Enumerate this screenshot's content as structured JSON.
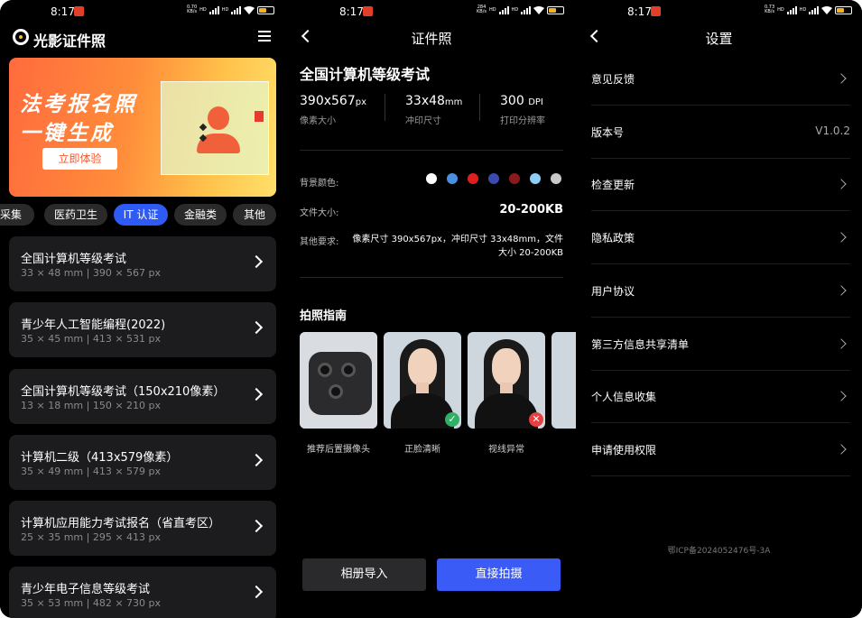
{
  "status_bar": [
    {
      "time": "8:17",
      "speed_top": "0.70",
      "speed_bottom": "KB/s",
      "battery": "80"
    },
    {
      "time": "8:17",
      "speed_top": "284",
      "speed_bottom": "KB/s",
      "battery": "80"
    },
    {
      "time": "8:17",
      "speed_top": "0.73",
      "speed_bottom": "KB/s",
      "battery": "80"
    }
  ],
  "home": {
    "app_name": "光影证件照",
    "banner": {
      "line1": "法考报名照",
      "line2": "一键生成",
      "button": "立即体验"
    },
    "tabs": [
      "采集",
      "医药卫生",
      "IT 认证",
      "金融类",
      "其他"
    ],
    "active_tab": "IT 认证",
    "items": [
      {
        "title": "全国计算机等级考试",
        "sub": "33 × 48 mm | 390 × 567 px"
      },
      {
        "title": "青少年人工智能编程(2022)",
        "sub": "35 × 45 mm | 413 × 531 px"
      },
      {
        "title": "全国计算机等级考试（150x210像素）",
        "sub": "13 × 18 mm | 150 × 210 px"
      },
      {
        "title": "计算机二级（413x579像素）",
        "sub": "35 × 49 mm | 413 × 579 px"
      },
      {
        "title": "计算机应用能力考试报名（省直考区）",
        "sub": "25 × 35 mm | 295 × 413 px"
      },
      {
        "title": "青少年电子信息等级考试",
        "sub": "35 × 53 mm | 482 × 730 px"
      }
    ]
  },
  "detail": {
    "nav_title": "证件照",
    "title": "全国计算机等级考试",
    "specs": [
      {
        "value": "390x567",
        "unit": "px",
        "label": "像素大小"
      },
      {
        "value": "33x48",
        "unit": "mm",
        "label": "冲印尺寸"
      },
      {
        "value": "300",
        "unit": "DPI",
        "label": "打印分辨率"
      }
    ],
    "bg_color_label": "背景颜色:",
    "bg_colors": [
      "#ffffff",
      "#4a90e2",
      "#e02020",
      "#3a4ab0",
      "#8b1a1a",
      "#8ecdf5",
      "#c9c9c9"
    ],
    "file_size_label": "文件大小:",
    "file_size": "20-200KB",
    "other_label": "其他要求:",
    "other_text": "像素尺寸 390x567px，冲印尺寸 33x48mm，文件大小 20-200KB",
    "guide_title": "拍照指南",
    "guides": [
      {
        "label": "推荐后置摄像头",
        "icon": "phone-camera"
      },
      {
        "label": "正脸清晰",
        "icon": "check",
        "color": "#2fb067"
      },
      {
        "label": "视线异常",
        "icon": "cross",
        "color": "#e84040"
      }
    ],
    "btn_album": "相册导入",
    "btn_shoot": "直接拍摄"
  },
  "settings": {
    "nav_title": "设置",
    "items": [
      {
        "label": "意见反馈",
        "value": ""
      },
      {
        "label": "版本号",
        "value": "V1.0.2"
      },
      {
        "label": "检查更新",
        "value": ""
      },
      {
        "label": "隐私政策",
        "value": ""
      },
      {
        "label": "用户协议",
        "value": ""
      },
      {
        "label": "第三方信息共享清单",
        "value": ""
      },
      {
        "label": "个人信息收集",
        "value": ""
      },
      {
        "label": "申请使用权限",
        "value": ""
      }
    ],
    "icp": "鄂ICP备2024052476号-3A"
  }
}
